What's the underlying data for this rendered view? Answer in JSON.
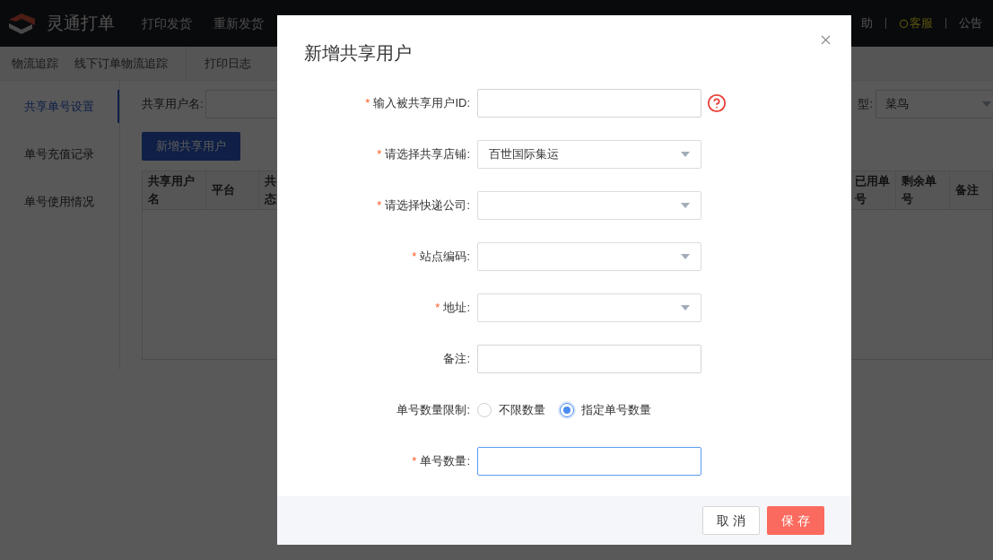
{
  "top_nav": {
    "brand": "灵通打单",
    "items": [
      "打印发货",
      "重新发货"
    ],
    "right_items": [
      {
        "label": "助",
        "kind": "text"
      },
      {
        "label": "客服",
        "kind": "service"
      },
      {
        "label": "公告",
        "kind": "text"
      }
    ]
  },
  "sub_nav": [
    [
      "物流追踪",
      "线下订单物流追踪"
    ],
    [
      "打印日志"
    ]
  ],
  "sidebar": {
    "items": [
      {
        "label": "共享单号设置",
        "selected": true
      },
      {
        "label": "单号充值记录",
        "selected": false
      },
      {
        "label": "单号使用情况",
        "selected": false
      }
    ]
  },
  "filter": {
    "username_label": "共享用户名:",
    "type_label": "型:",
    "type_value": "菜鸟"
  },
  "add_button": "新增共享用户",
  "table": {
    "columns_left": [
      "共享用户名",
      "平台",
      "共态"
    ],
    "columns_right": [
      "已用单号",
      "剩余单号",
      "备注"
    ]
  },
  "dialog": {
    "title": "新增共享用户",
    "fields": [
      {
        "kind": "input",
        "marker": "*",
        "label": "输入被共享用户ID:",
        "help": true,
        "focused": false
      },
      {
        "kind": "select",
        "marker": "*",
        "label": "请选择共享店铺:",
        "value": "百世国际集运"
      },
      {
        "kind": "select",
        "marker": "*",
        "label": "请选择快递公司:"
      },
      {
        "kind": "select",
        "marker": "*",
        "label": "站点编码:"
      },
      {
        "kind": "select",
        "marker": "*",
        "label": "地址:"
      },
      {
        "kind": "input",
        "label": "备注:",
        "focused": false
      },
      {
        "kind": "radio",
        "label": "单号数量限制:",
        "options": [
          {
            "label": "不限数量",
            "selected": false
          },
          {
            "label": "指定单号数量",
            "selected": true
          }
        ]
      },
      {
        "kind": "input",
        "marker": "*",
        "label": "单号数量:",
        "focused": true
      }
    ],
    "buttons": [
      {
        "label": "取 消",
        "kind": "secondary"
      },
      {
        "label": "保 存",
        "kind": "primary"
      }
    ]
  }
}
